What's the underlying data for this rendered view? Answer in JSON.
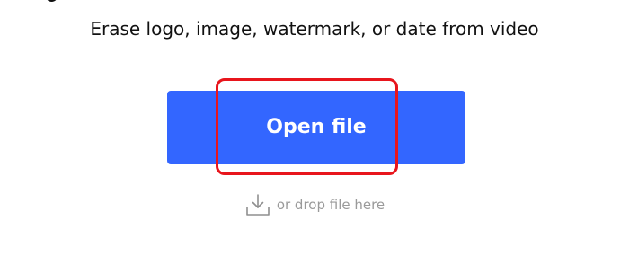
{
  "subtitle": "Erase logo, image, watermark, or date from video",
  "open_file": {
    "label": "Open file"
  },
  "drop_zone": {
    "text": "or drop file here",
    "icon": "download-tray-icon"
  },
  "colors": {
    "button_background": "#3366ff",
    "button_text": "#ffffff",
    "highlight_border": "#e8151c",
    "hint_text": "#9a9a9a",
    "subtitle_text": "#111111"
  }
}
